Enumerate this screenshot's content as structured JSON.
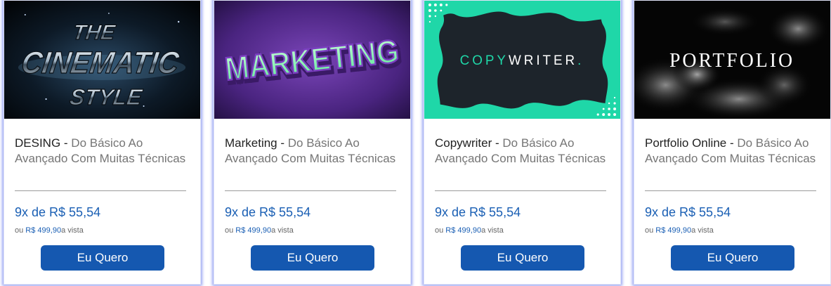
{
  "cards": [
    {
      "image_text_lines": [
        "THE",
        "CINEMATIC",
        "STYLE"
      ],
      "title": "DESING",
      "separator": " - ",
      "subtitle": "Do Básico Ao Avançado Com Muitas Técnicas",
      "installments": "9x de R$ 55,54",
      "cash_prefix": "ou ",
      "cash_price": "R$ 499,90",
      "cash_suffix": "a vista",
      "button_label": "Eu Quero"
    },
    {
      "image_text": "MARKETING",
      "title": "Marketing",
      "separator": " - ",
      "subtitle": "Do Básico Ao Avançado Com Muitas Técnicas",
      "installments": "9x de R$ 55,54",
      "cash_prefix": "ou ",
      "cash_price": "R$ 499,90",
      "cash_suffix": "a vista",
      "button_label": "Eu Quero"
    },
    {
      "image_text_a": "COPY",
      "image_text_b": "WRITER",
      "image_text_c": ".",
      "title": "Copywriter",
      "separator": " - ",
      "subtitle": "Do Básico Ao Avançado Com Muitas Técnicas",
      "installments": "9x de R$ 55,54",
      "cash_prefix": "ou ",
      "cash_price": "R$ 499,90",
      "cash_suffix": "a vista",
      "button_label": "Eu Quero"
    },
    {
      "image_text": "PORTFOLIO",
      "title": "Portfolio Online",
      "separator": " - ",
      "subtitle": "Do Básico Ao Avançado Com Muitas Técnicas",
      "installments": "9x de R$ 55,54",
      "cash_prefix": "ou ",
      "cash_price": "R$ 499,90",
      "cash_suffix": "a vista",
      "button_label": "Eu Quero"
    }
  ],
  "colors": {
    "price_blue": "#1a5fb4",
    "button_blue": "#1558b0",
    "card_glow": "#9aa6f3",
    "copywriter_teal": "#1fd7a8"
  }
}
